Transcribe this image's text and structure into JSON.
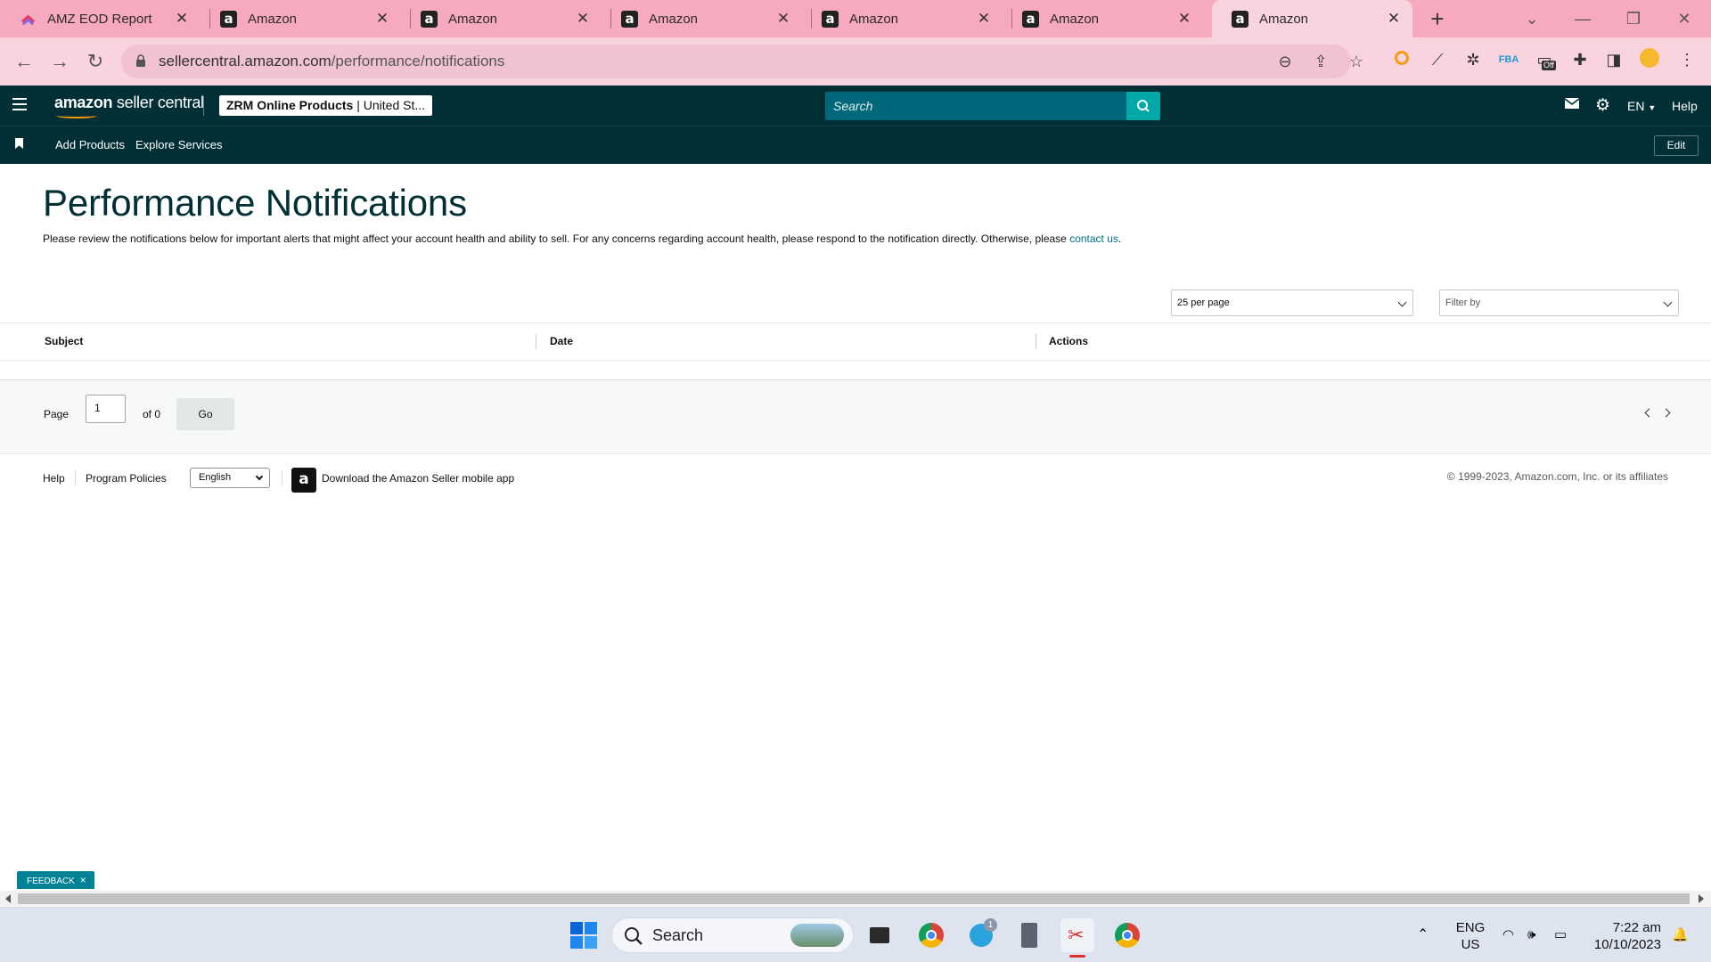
{
  "browser": {
    "tabs": [
      {
        "title": "AMZ EOD Report",
        "favicon": "clickup-icon"
      },
      {
        "title": "Amazon",
        "favicon": "amazon-a-icon"
      },
      {
        "title": "Amazon",
        "favicon": "amazon-a-icon"
      },
      {
        "title": "Amazon",
        "favicon": "amazon-a-icon"
      },
      {
        "title": "Amazon",
        "favicon": "amazon-a-icon"
      },
      {
        "title": "Amazon",
        "favicon": "amazon-a-icon"
      },
      {
        "title": "Amazon",
        "favicon": "amazon-a-icon",
        "active": true
      }
    ],
    "url_domain": "sellercentral.amazon.com",
    "url_path": "/performance/notifications",
    "extension_badge": "Off"
  },
  "header": {
    "logo_main": "amazon",
    "logo_sub": " seller central",
    "account_name": "ZRM Online Products",
    "account_region": "United St...",
    "search_placeholder": "Search",
    "language": "EN",
    "help": "Help"
  },
  "subnav": {
    "links": [
      "Add Products",
      "Explore Services"
    ],
    "edit": "Edit"
  },
  "main": {
    "title": "Performance Notifications",
    "intro_text": "Please review the notifications below for important alerts that might affect your account health and ability to sell. For any concerns regarding account health, please respond to the notification directly. Otherwise, please ",
    "intro_link": "contact us",
    "intro_end": ".",
    "per_page": "25 per page",
    "filter_placeholder": "Filter by",
    "table": {
      "columns": [
        "Subject",
        "Date",
        "Actions"
      ],
      "rows": []
    },
    "pager": {
      "page_label": "Page",
      "current_page": "1",
      "of_label": "of 0",
      "go": "Go"
    }
  },
  "footer": {
    "help": "Help",
    "policies": "Program Policies",
    "language": "English",
    "app_text": "Download the Amazon Seller mobile app",
    "copyright": "© 1999-2023, Amazon.com, Inc. or its affiliates"
  },
  "feedback": {
    "label": "FEEDBACK",
    "close": "×"
  },
  "taskbar": {
    "search_placeholder": "Search",
    "language_line1": "ENG",
    "language_line2": "US",
    "time": "7:22 am",
    "date": "10/10/2023",
    "telegram_badge": "1"
  },
  "colors": {
    "tab_strip": "#f7a9bf",
    "active_tab": "#f9d4df",
    "amazon_header": "#002f36",
    "search_bg": "#00687a",
    "search_button": "#00a8a8",
    "link": "#007185",
    "title": "#002f36",
    "feedback": "#008296"
  }
}
